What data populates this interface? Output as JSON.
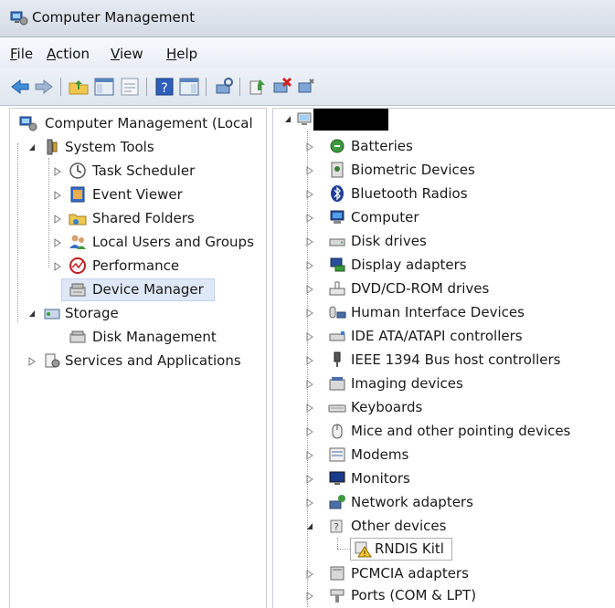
{
  "window": {
    "title": "Computer Management"
  },
  "menu": [
    {
      "label": "File",
      "u": "F",
      "rest": "ile"
    },
    {
      "label": "Action",
      "u": "A",
      "rest": "ction"
    },
    {
      "label": "View",
      "u": "V",
      "rest": "iew"
    },
    {
      "label": "Help",
      "u": "H",
      "rest": "elp"
    }
  ],
  "toolbar": [
    "back-arrow-icon",
    "forward-arrow-icon",
    "up-folder-icon",
    "show-hide-tree-icon",
    "properties-icon",
    "help-icon",
    "show-hide-action-pane-icon",
    "scan-hardware-icon",
    "update-driver-icon",
    "uninstall-device-icon",
    "disable-device-icon"
  ],
  "left_tree": {
    "root": "Computer Management (Local",
    "system_tools": "System Tools",
    "task_scheduler": "Task Scheduler",
    "event_viewer": "Event Viewer",
    "shared_folders": "Shared Folders",
    "local_users": "Local Users and Groups",
    "performance": "Performance",
    "device_manager": "Device Manager",
    "storage": "Storage",
    "disk_management": "Disk Management",
    "services": "Services and Applications"
  },
  "devices": {
    "batteries": "Batteries",
    "biometric": "Biometric Devices",
    "bluetooth": "Bluetooth Radios",
    "computer": "Computer",
    "disk": "Disk drives",
    "display": "Display adapters",
    "dvd": "DVD/CD-ROM drives",
    "hid": "Human Interface Devices",
    "ide": "IDE ATA/ATAPI controllers",
    "ieee": "IEEE 1394 Bus host controllers",
    "imaging": "Imaging devices",
    "keyboards": "Keyboards",
    "mice": "Mice and other pointing devices",
    "modems": "Modems",
    "monitors": "Monitors",
    "network": "Network adapters",
    "other": "Other devices",
    "rndis": "RNDIS Kitl",
    "pcmcia": "PCMCIA adapters",
    "ports": "Ports (COM & LPT)"
  },
  "colors": {
    "selection": "#dfe8f6",
    "titlebar": "#d4dbe6",
    "warning": "#f4c430"
  }
}
